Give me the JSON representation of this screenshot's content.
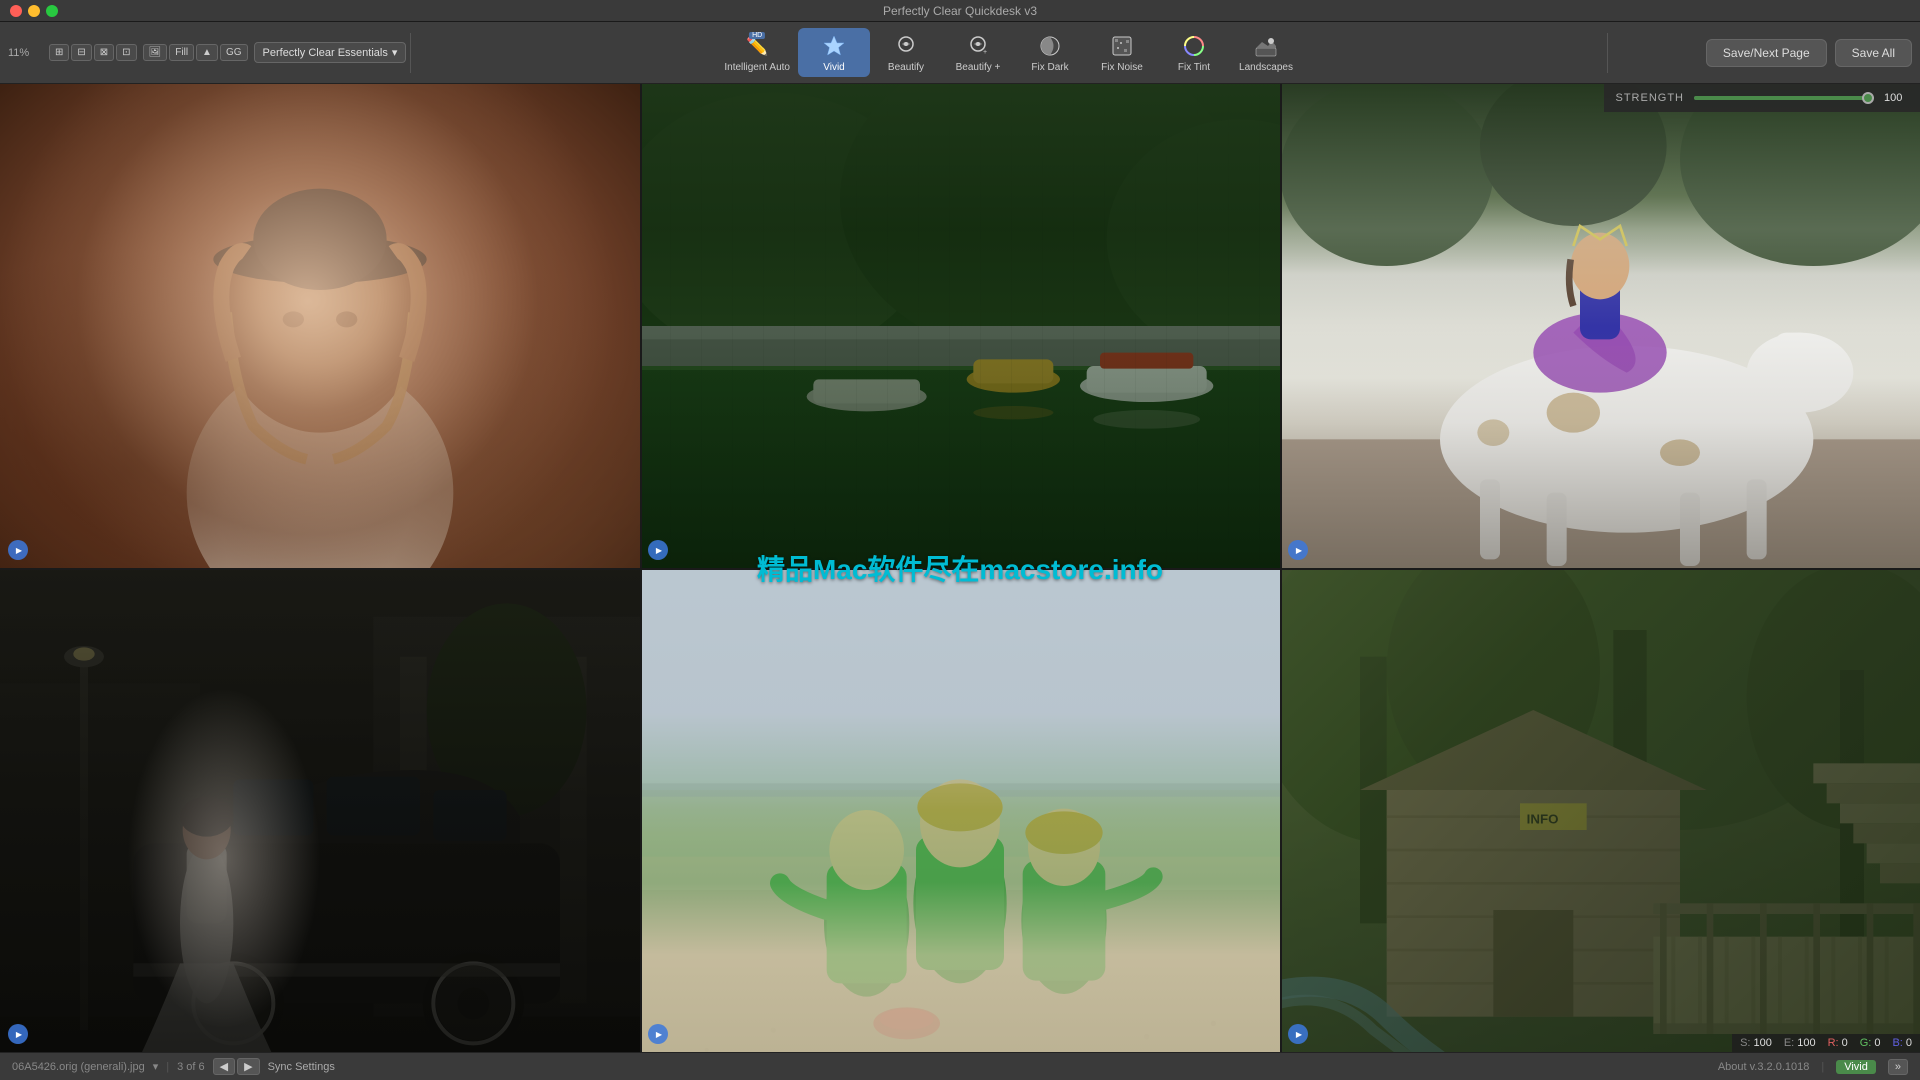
{
  "window": {
    "title": "Perfectly Clear Quickdesk v3"
  },
  "toolbar": {
    "zoom": "11%",
    "preset": "Perfectly Clear Essentials",
    "tools": [
      {
        "id": "intelligent-auto",
        "label": "Intelligent Auto",
        "hd": true,
        "active": false
      },
      {
        "id": "vivid",
        "label": "Vivid",
        "active": true
      },
      {
        "id": "beautify",
        "label": "Beautify",
        "active": false
      },
      {
        "id": "beautify-plus",
        "label": "Beautify +",
        "active": false
      },
      {
        "id": "fix-dark",
        "label": "Fix Dark",
        "active": false
      },
      {
        "id": "fix-noise",
        "label": "Fix Noise",
        "active": false
      },
      {
        "id": "fix-tint",
        "label": "Fix Tint",
        "active": false
      },
      {
        "id": "landscapes",
        "label": "Landscapes",
        "active": false
      }
    ],
    "save_next_label": "Save/Next Page",
    "save_all_label": "Save All"
  },
  "strength_panel": {
    "label": "STRENGTH",
    "value": 100
  },
  "color_values": {
    "s_label": "S:",
    "s_value": "100",
    "e_label": "E:",
    "e_value": "100",
    "r_label": "R:",
    "r_value": "0",
    "g_label": "G:",
    "g_value": "0",
    "b_label": "B:",
    "b_value": "0"
  },
  "photos": [
    {
      "id": "photo-1",
      "alt": "Girl with hat warm bokeh"
    },
    {
      "id": "photo-2",
      "alt": "Boats on green mountain water"
    },
    {
      "id": "photo-3",
      "alt": "Girl in purple dress on horse"
    },
    {
      "id": "photo-4",
      "alt": "Bride with vintage car"
    },
    {
      "id": "photo-5",
      "alt": "Three kids on beach in green jackets"
    },
    {
      "id": "photo-6",
      "alt": "Wooden shed and bridge in forest"
    }
  ],
  "watermark": {
    "text": "精品Mac软件尽在macstore.info"
  },
  "status_bar": {
    "filename": "06A5426.orig (generali).jpg",
    "page_info": "3 of 6",
    "sync_settings": "Sync Settings",
    "about": "About v.3.2.0.1018",
    "vivid_badge": "Vivid",
    "expand_label": "»"
  }
}
